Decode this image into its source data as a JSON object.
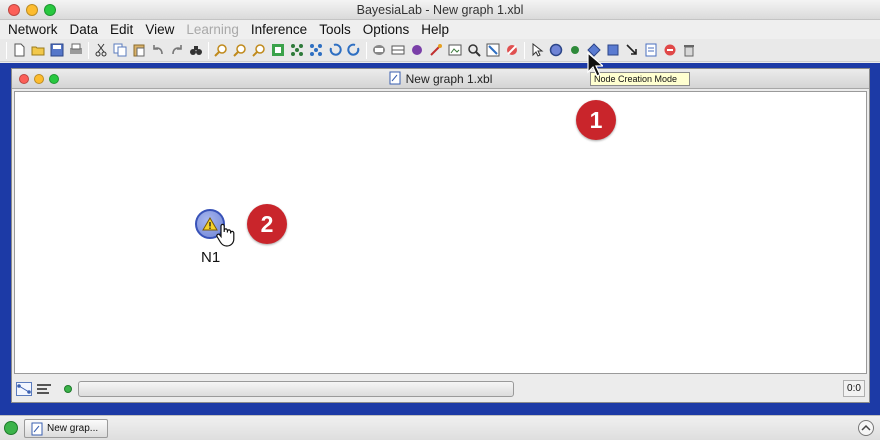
{
  "window": {
    "title": "BayesiaLab - New graph 1.xbl"
  },
  "menu": [
    {
      "label": "Network",
      "enabled": true
    },
    {
      "label": "Data",
      "enabled": true
    },
    {
      "label": "Edit",
      "enabled": true
    },
    {
      "label": "View",
      "enabled": true
    },
    {
      "label": "Learning",
      "enabled": false
    },
    {
      "label": "Inference",
      "enabled": true
    },
    {
      "label": "Tools",
      "enabled": true
    },
    {
      "label": "Options",
      "enabled": true
    },
    {
      "label": "Help",
      "enabled": true
    }
  ],
  "toolbar": {
    "tooltip": "Node Creation Mode",
    "icons": [
      "new-file-icon",
      "open-folder-icon",
      "save-icon",
      "print-icon",
      "cut-icon",
      "copy-icon",
      "paste-icon",
      "undo-icon",
      "redo-icon",
      "find-icon",
      "zoom-in-icon",
      "zoom-out-icon",
      "zoom-fit-icon",
      "layout-grid-icon",
      "layout-tree-icon",
      "layout-spring-icon",
      "rotate-left-icon",
      "rotate-right-icon",
      "node-creation-mode-icon"
    ]
  },
  "document": {
    "title": "New graph 1.xbl"
  },
  "node": {
    "label": "N1",
    "icon": "warning-icon"
  },
  "annotations": [
    {
      "number": "1"
    },
    {
      "number": "2"
    }
  ],
  "status": {
    "coordinates": "0:0",
    "indicator_color": "#3bb34a"
  },
  "taskbar": {
    "item_label": "New grap..."
  },
  "colors": {
    "desktop": "#1c3aa6",
    "node_fill": "#7b8fdc",
    "node_border": "#3852b8",
    "badge": "#c9252b"
  }
}
